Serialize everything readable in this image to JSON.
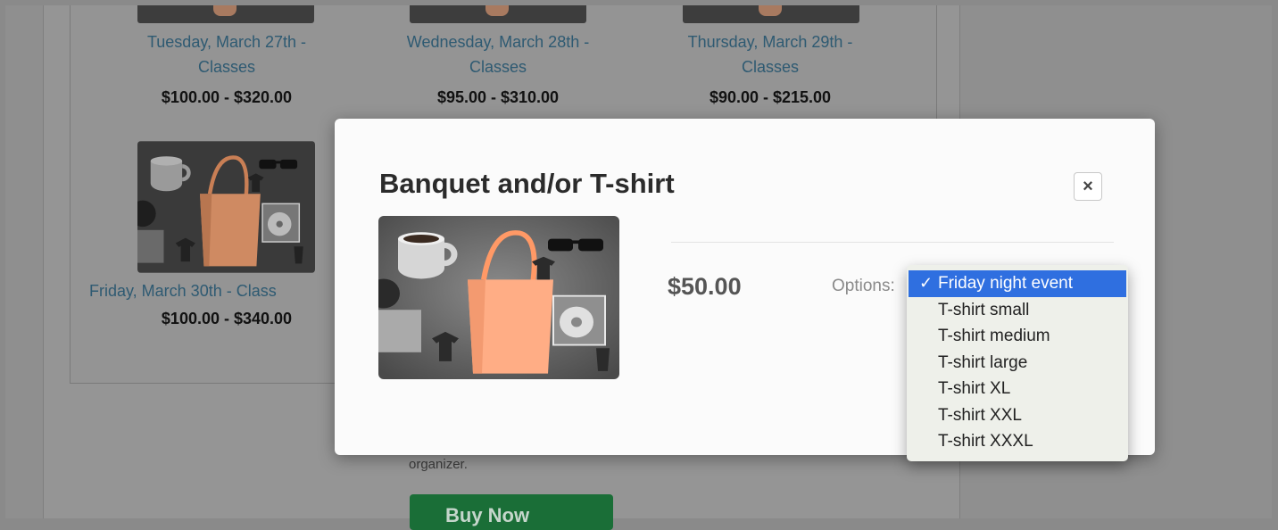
{
  "products": [
    {
      "name": "Tuesday, March 27th - Classes",
      "line1": "Tuesday, March 27th -",
      "line2": "Classes",
      "price": "$100.00 - $320.00"
    },
    {
      "name": "Wednesday, March 28th - Classes",
      "line1": "Wednesday, March 28th -",
      "line2": "Classes",
      "price": "$95.00 - $310.00"
    },
    {
      "name": "Thursday, March 29th - Classes",
      "line1": "Thursday, March 29th -",
      "line2": "Classes",
      "price": "$90.00 - $215.00"
    },
    {
      "name": "Friday, March 30th - Classes",
      "line1": "Friday, March 30th - Class",
      "price": "$100.00 - $340.00"
    }
  ],
  "background": {
    "organizer_text": "organizer.",
    "register_button_label": "Buy Now"
  },
  "modal": {
    "title": "Banquet and/or T-shirt",
    "close_label": "×",
    "price": "$50.00",
    "options_label": "Options:"
  },
  "dropdown": {
    "check_mark": "✓",
    "selected": "Friday night event",
    "options": [
      "Friday night event",
      "T-shirt small",
      "T-shirt medium",
      "T-shirt large",
      "T-shirt XL",
      "T-shirt XXL",
      "T-shirt XXXL"
    ]
  },
  "icons": {
    "product_image": "shopping-bag-illustration-icon",
    "close": "close-icon",
    "check": "check-icon"
  },
  "colors": {
    "link": "#2e5a72",
    "selected_option": "#2f6fe0",
    "register_button": "#1a6e37"
  }
}
